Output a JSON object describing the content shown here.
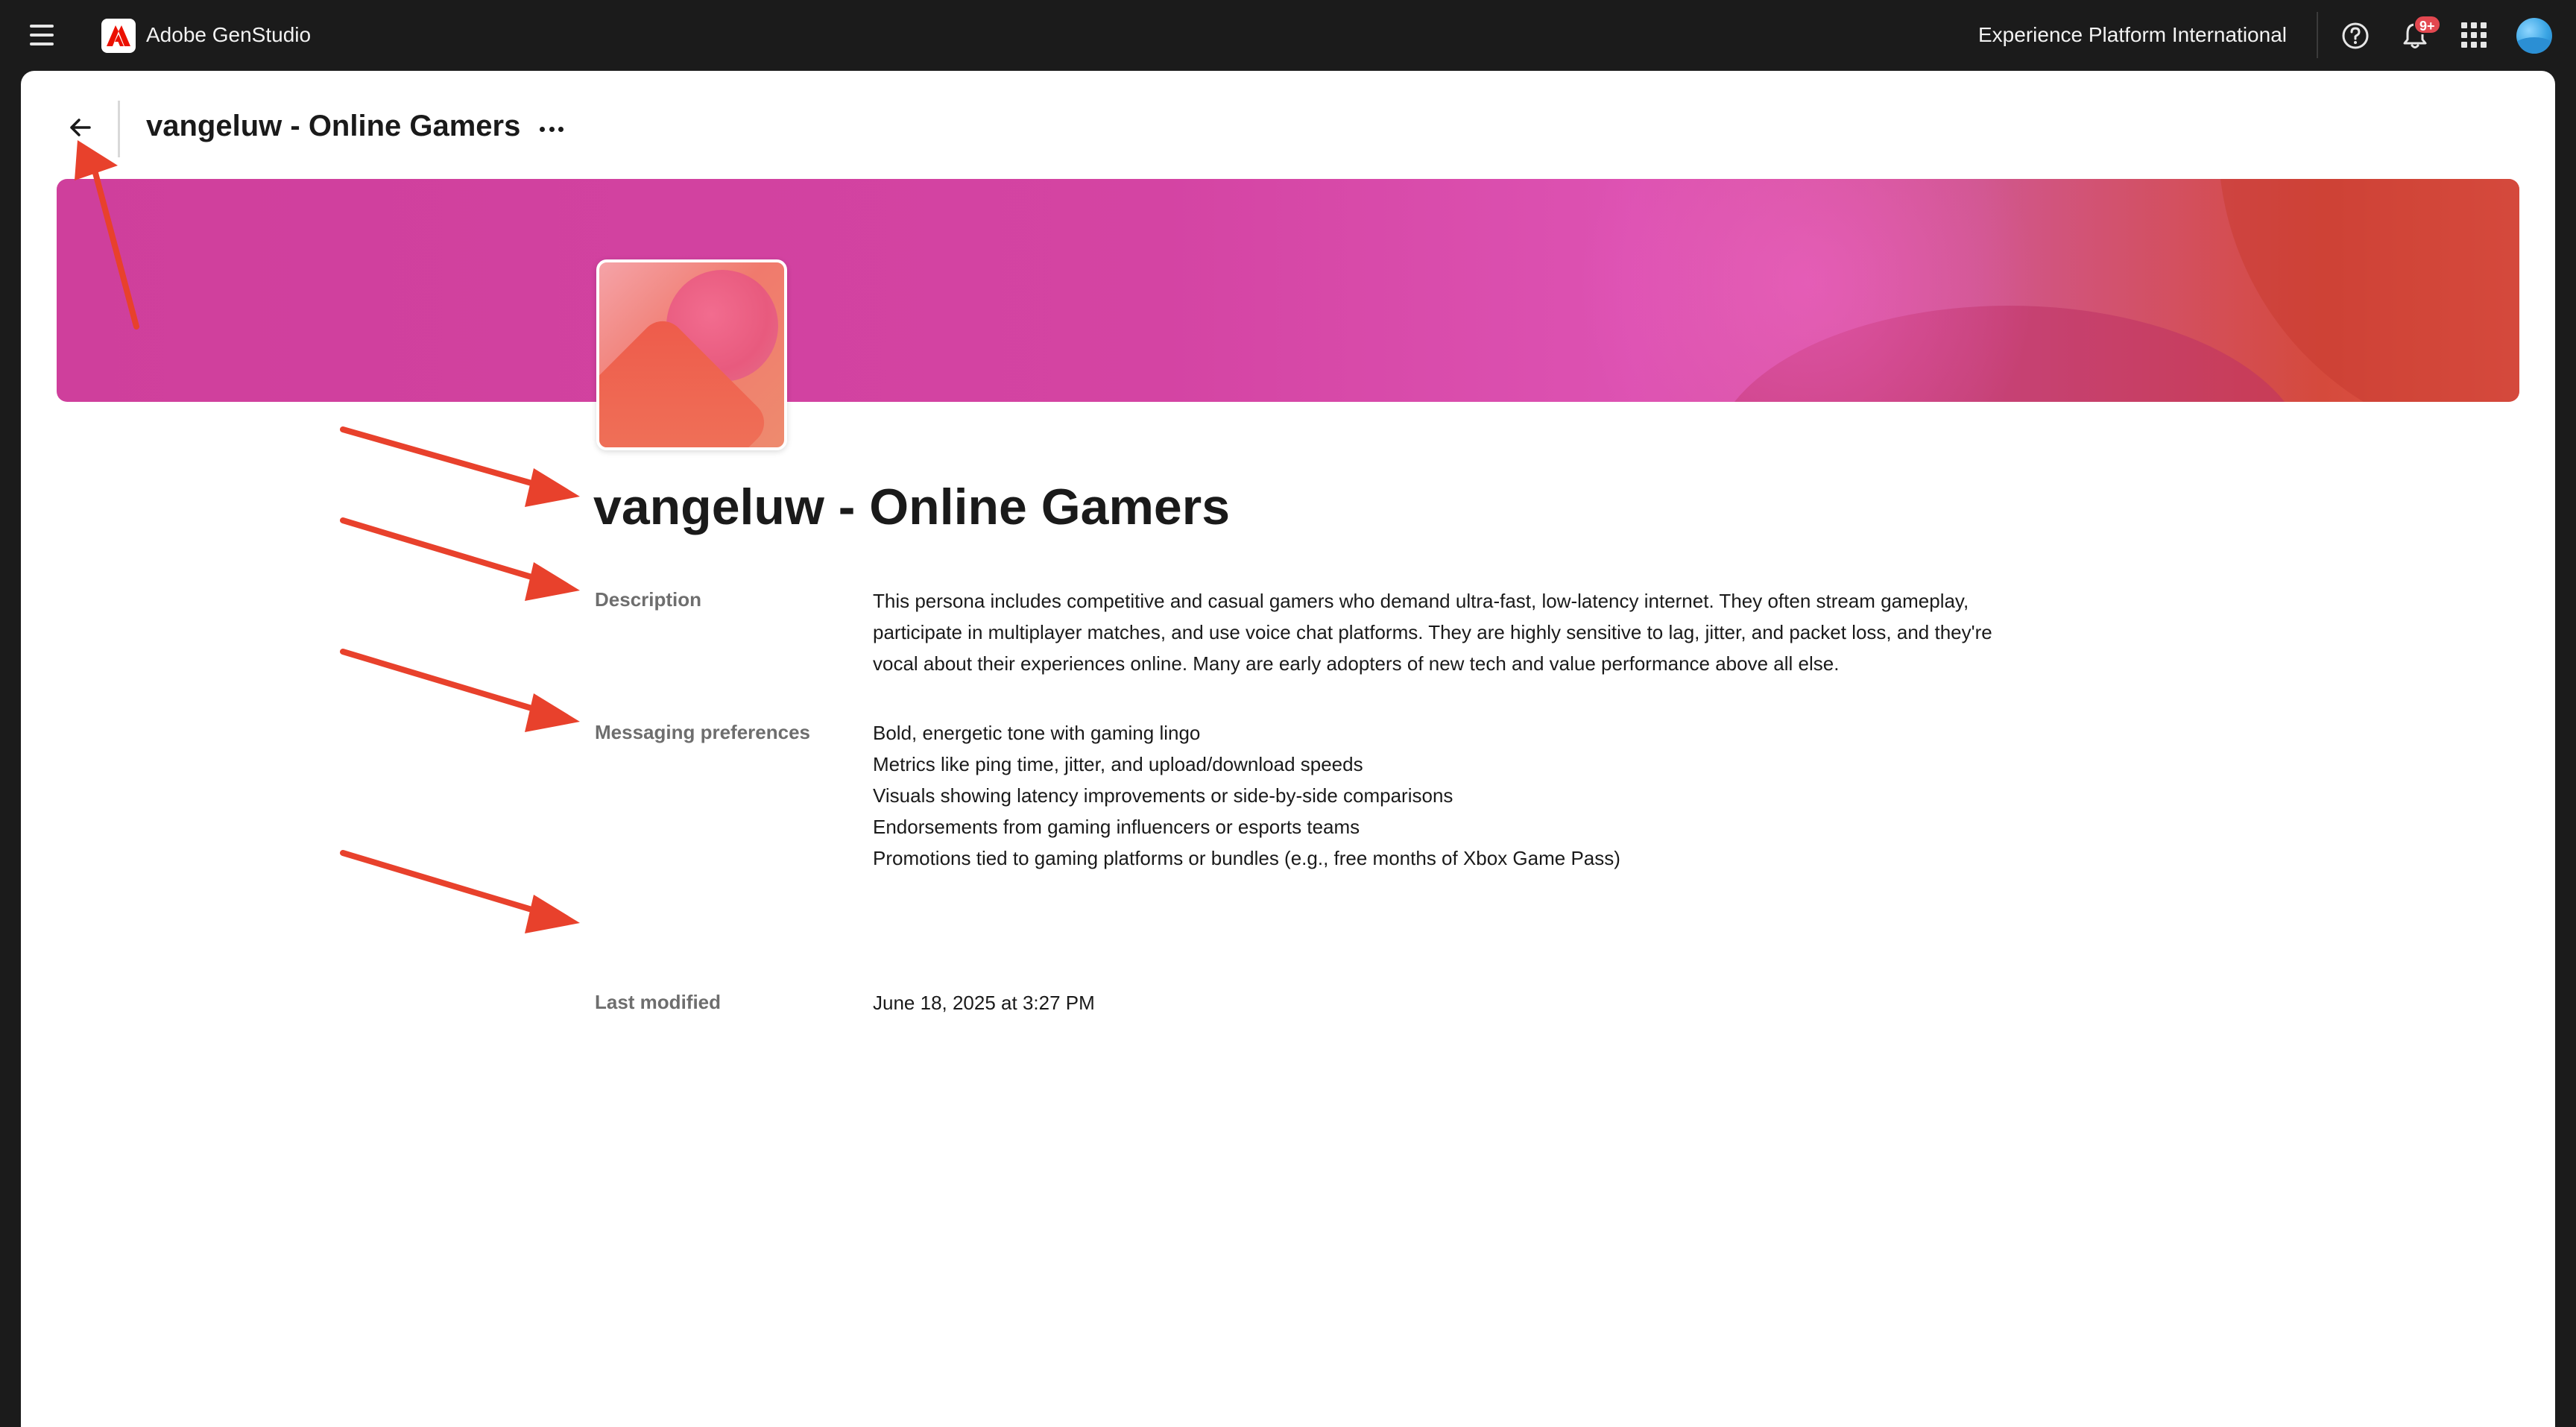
{
  "topbar": {
    "app_name": "Adobe GenStudio",
    "org_name": "Experience Platform International",
    "notification_badge": "9+",
    "icons": [
      "menu-icon",
      "adobe-logo-icon",
      "help-icon",
      "bell-icon",
      "apps-grid-icon",
      "avatar"
    ]
  },
  "header": {
    "title": "vangeluw - Online Gamers",
    "icons": [
      "back-arrow-icon",
      "more-icon"
    ]
  },
  "persona": {
    "title": "vangeluw - Online Gamers",
    "description_label": "Description",
    "description": "This persona includes competitive and casual gamers who demand ultra-fast, low-latency internet. They often stream gameplay, participate in multiplayer matches, and use voice chat platforms. They are highly sensitive to lag, jitter, and packet loss, and they're vocal about their experiences online. Many are early adopters of new tech and value performance above all else.",
    "messaging_label": "Messaging preferences",
    "messaging_preferences": [
      "Bold, energetic tone with gaming lingo",
      "Metrics like ping time, jitter, and upload/download speeds",
      "Visuals showing latency improvements or side-by-side comparisons",
      "Endorsements from gaming influencers or esports teams",
      "Promotions tied to gaming platforms or bundles (e.g., free months of Xbox Game Pass)"
    ],
    "last_modified_label": "Last modified",
    "last_modified": "June 18, 2025 at 3:27 PM"
  },
  "colors": {
    "topbar_bg": "#1b1b1b",
    "annotation_arrow": "#e8412c",
    "banner_pink": "#d444a3",
    "banner_orange": "#e45a4a",
    "badge_red": "#e34850"
  }
}
